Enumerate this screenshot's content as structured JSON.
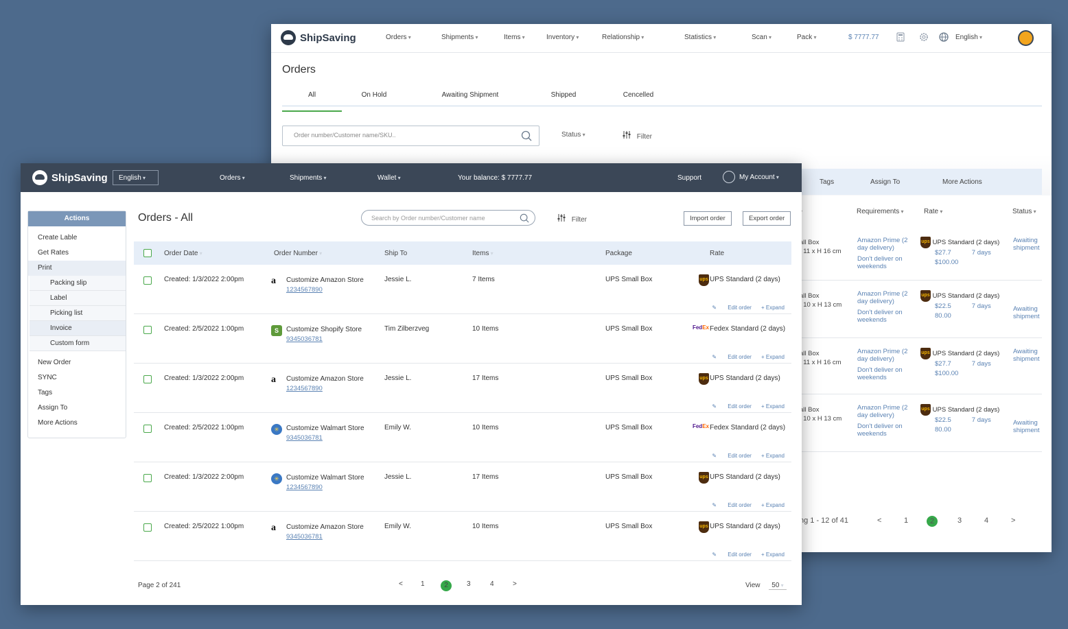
{
  "back": {
    "brand": "ShipSaving",
    "nav": [
      "Orders",
      "Shipments",
      "Items",
      "Inventory",
      "Relationship",
      "Statistics",
      "Scan",
      "Pack"
    ],
    "balance": "$ 7777.77",
    "language": "English",
    "page_title": "Orders",
    "tabs": [
      "All",
      "On Hold",
      "Awaiting Shipment",
      "Shipped",
      "Cencelled"
    ],
    "search_placeholder": "Order number/Customer name/SKU..",
    "status_label": "Status",
    "filter_label": "Filter",
    "bulk_actions": [
      "Tags",
      "Assign To",
      "More Actions"
    ],
    "columns": [
      "Requirements",
      "Rate",
      "Status"
    ],
    "rows": [
      {
        "pkg1": "all Box",
        "pkg2": "/ 11 x H 16 cm",
        "req1": "Amazon Prime (2 day delivery)",
        "req2": "Don't deliver on weekends",
        "rate": "UPS Standard  (2 days)",
        "price": "$27.7",
        "days": "7 days",
        "extra": "$100.00",
        "status": "Awaiting shipment"
      },
      {
        "pkg1": "all Box",
        "pkg2": "/ 10 x H 13 cm",
        "req1": "Amazon Prime (2 day delivery)",
        "req2": "Don't deliver on weekends",
        "rate": "UPS Standard  (2 days)",
        "price": "$22.5",
        "days": "7 days",
        "extra": "80.00",
        "status": "Awaiting shipment"
      },
      {
        "pkg1": "all Box",
        "pkg2": "/ 11 x H 16 cm",
        "req1": "Amazon Prime (2 day delivery)",
        "req2": "Don't deliver on weekends",
        "rate": "UPS Standard  (2 days)",
        "price": "$27.7",
        "days": "7 days",
        "extra": "$100.00",
        "status": "Awaiting shipment"
      },
      {
        "pkg1": "all Box",
        "pkg2": "/ 10 x H 13 cm",
        "req1": "Amazon Prime (2 day delivery)",
        "req2": "Don't deliver on weekends",
        "rate": "UPS Standard  (2 days)",
        "price": "$22.5",
        "days": "7 days",
        "extra": "80.00",
        "status": "Awaiting shipment"
      }
    ],
    "pager_info": "ng 1 - 12 of 41",
    "pager": [
      "<",
      "1",
      "2",
      "3",
      "4",
      ">"
    ]
  },
  "front": {
    "brand": "ShipSaving",
    "language": "English",
    "nav": [
      "Orders",
      "Shipments",
      "Wallet"
    ],
    "balance": "Your balance: $ 7777.77",
    "support": "Support",
    "account": "My Account",
    "sidebar": {
      "header": "Actions",
      "top": [
        "Create Lable",
        "Get Rates",
        "Print"
      ],
      "print_sub": [
        "Packing slip",
        "Label",
        "Picking list",
        "Invoice",
        "Custom form"
      ],
      "bottom": [
        "New Order",
        "SYNC",
        "Tags",
        "Assign To",
        "More Actions"
      ]
    },
    "title": "Orders - All",
    "search_placeholder": "Search by Order number/Customer name",
    "filter_label": "Filter",
    "import_label": "Import order",
    "export_label": "Export order",
    "columns": [
      "Order Date",
      "Order Number",
      "Ship To",
      "Items",
      "Package",
      "Rate"
    ],
    "rows": [
      {
        "date": "Created: 1/3/2022 2:00pm",
        "store": "Customize Amazon Store",
        "store_type": "amazon",
        "number": "1234567890",
        "ship_to": "Jessie L.",
        "items": "7 Items",
        "package": "UPS Small Box",
        "carrier": "ups",
        "rate": "UPS Standard  (2 days)"
      },
      {
        "date": "Created: 2/5/2022 1:00pm",
        "store": "Customize Shopify Store",
        "store_type": "shopify",
        "number": "9345036781",
        "ship_to": "Tim Zilberzveg",
        "items": "10 Items",
        "package": "UPS Small Box",
        "carrier": "fedex",
        "rate": "Fedex Standard  (2 days)"
      },
      {
        "date": "Created: 1/3/2022 2:00pm",
        "store": "Customize Amazon Store",
        "store_type": "amazon",
        "number": "1234567890",
        "ship_to": "Jessie L.",
        "items": "17 Items",
        "package": "UPS Small Box",
        "carrier": "ups",
        "rate": "UPS Standard  (2 days)"
      },
      {
        "date": "Created: 2/5/2022 1:00pm",
        "store": "Customize Walmart Store",
        "store_type": "walmart",
        "number": "9345036781",
        "ship_to": "Emily W.",
        "items": "10 Items",
        "package": "UPS Small Box",
        "carrier": "fedex",
        "rate": "Fedex Standard  (2 days)"
      },
      {
        "date": "Created: 1/3/2022 2:00pm",
        "store": "Customize Walmart  Store",
        "store_type": "walmart",
        "number": "1234567890",
        "ship_to": "Jessie L.",
        "items": "17 Items",
        "package": "UPS Small Box",
        "carrier": "ups",
        "rate": "UPS Standard  (2 days)"
      },
      {
        "date": "Created: 2/5/2022 1:00pm",
        "store": "Customize Amazon Store",
        "store_type": "amazon",
        "number": "9345036781",
        "ship_to": "Emily W.",
        "items": "10 Items",
        "package": "UPS Small Box",
        "carrier": "ups",
        "rate": "UPS Standard  (2 days)"
      }
    ],
    "edit_label": "Edit order",
    "expand_label": "+ Expand",
    "page_info": "Page 2 of 241",
    "pager": [
      "<",
      "1",
      "2",
      "3",
      "4",
      ">"
    ],
    "view_label": "View",
    "view_value": "50",
    "accent_green": "#36a84a",
    "nav_bg": "#3b4757"
  }
}
